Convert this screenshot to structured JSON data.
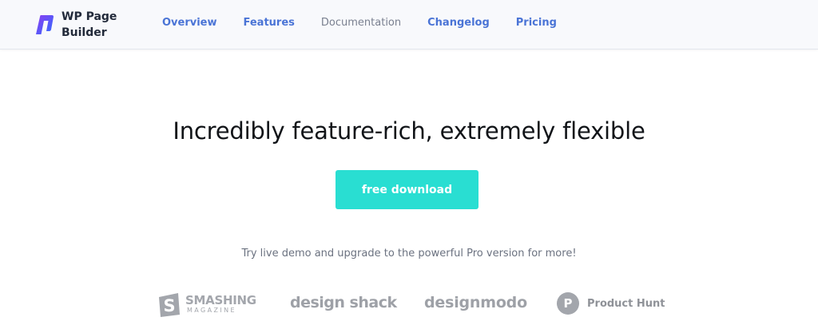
{
  "brand": {
    "name": "WP Page Builder",
    "logo_icon": "brand-logo-icon",
    "logo_colors": [
      "#7b3ff2",
      "#2f6bff"
    ]
  },
  "nav": {
    "items": [
      {
        "label": "Overview",
        "muted": false
      },
      {
        "label": "Features",
        "muted": false
      },
      {
        "label": "Documentation",
        "muted": true
      },
      {
        "label": "Changelog",
        "muted": false
      },
      {
        "label": "Pricing",
        "muted": false
      }
    ]
  },
  "hero": {
    "headline": "Incredibly feature-rich, extremely flexible",
    "cta_label": "free download",
    "cta_color": "#29ded2",
    "subtext": "Try live demo and upgrade to the powerful Pro version for more!"
  },
  "logos": {
    "smashing": {
      "line1": "SMASHING",
      "line2": "MAGAZINE",
      "icon": "smashing-s-icon"
    },
    "designshack": {
      "label": "design shack"
    },
    "designmodo": {
      "label": "designmodo"
    },
    "producthunt": {
      "letter": "P",
      "label": "Product Hunt",
      "icon": "product-hunt-icon"
    }
  }
}
